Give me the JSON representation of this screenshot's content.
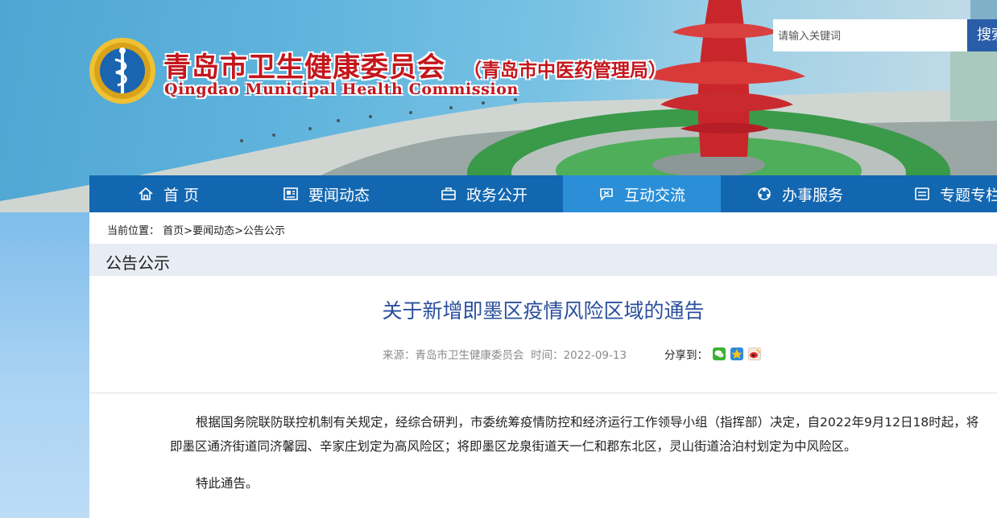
{
  "header": {
    "title_cn": "青岛市卫生健康委员会",
    "title_sub": "（青岛市中医药管理局）",
    "title_en": "Qingdao Municipal Health Commission",
    "logo_icon": "health-caduceus-seal-icon"
  },
  "search": {
    "placeholder": "请输入关键词",
    "button_label": "搜索"
  },
  "nav": {
    "items": [
      {
        "label": "首 页",
        "icon": "home-icon"
      },
      {
        "label": "要闻动态",
        "icon": "news-icon"
      },
      {
        "label": "政务公开",
        "icon": "briefcase-icon"
      },
      {
        "label": "互动交流",
        "icon": "interaction-icon",
        "active": true
      },
      {
        "label": "办事服务",
        "icon": "service-icon"
      },
      {
        "label": "专题专栏",
        "icon": "topic-icon"
      }
    ],
    "active_color": "#2b8fd7",
    "bar_color": "#1367b1"
  },
  "breadcrumb": {
    "prefix": "当前位置：",
    "items": [
      "首页",
      "要闻动态",
      "公告公示"
    ],
    "separator": ">"
  },
  "section": {
    "title": "公告公示"
  },
  "article": {
    "title": "关于新增即墨区疫情风险区域的通告",
    "source_label": "来源：",
    "source": "青岛市卫生健康委员会",
    "time_label": "时间：",
    "time": "2022-09-13",
    "share_label": "分享到：",
    "share_icons": [
      "wechat-icon",
      "qzone-icon",
      "weibo-icon"
    ],
    "paragraphs": [
      "根据国务院联防联控机制有关规定，经综合研判，市委统筹疫情防控和经济运行工作领导小组（指挥部）决定，自2022年9月12日18时起，将即墨区通济街道同济馨园、辛家庄划定为高风险区；将即墨区龙泉街道天一仁和郡东北区，灵山街道洽泊村划定为中风险区。",
      "特此通告。"
    ]
  }
}
